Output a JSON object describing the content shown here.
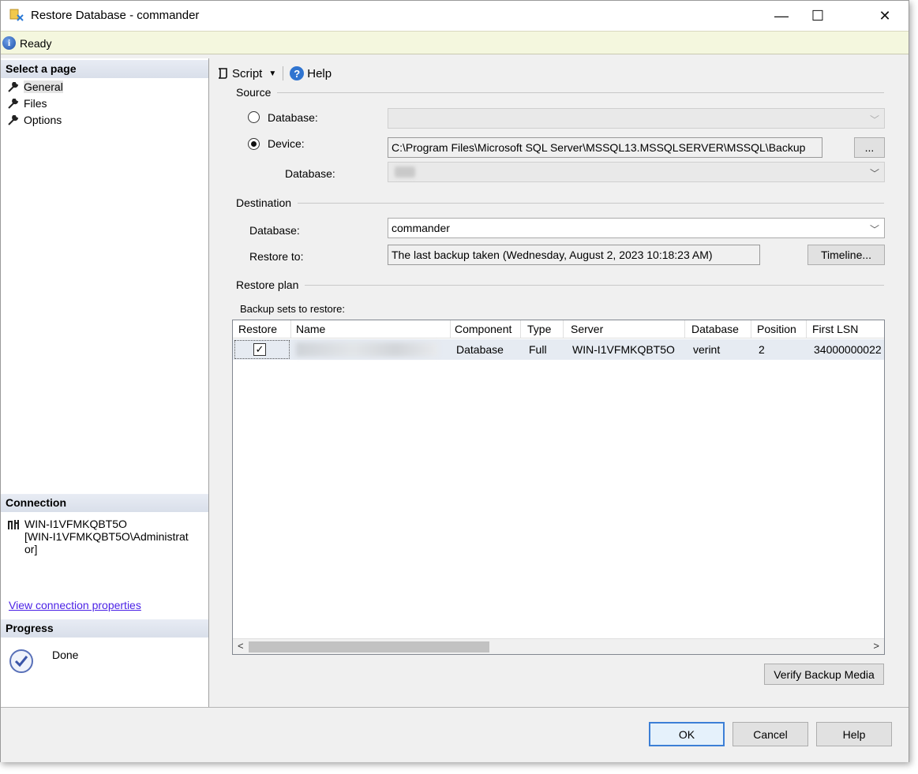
{
  "window": {
    "title": "Restore Database - commander"
  },
  "status": {
    "text": "Ready"
  },
  "sidebar": {
    "select_page_header": "Select a page",
    "pages": [
      {
        "label": "General"
      },
      {
        "label": "Files"
      },
      {
        "label": "Options"
      }
    ],
    "connection_header": "Connection",
    "connection_lines": [
      "WIN-I1VFMKQBT5O",
      "[WIN-I1VFMKQBT5O\\Administrat",
      "or]"
    ],
    "view_connection_link": "View connection properties",
    "progress_header": "Progress",
    "progress_status": "Done"
  },
  "toolbar": {
    "script_label": "Script",
    "help_label": "Help"
  },
  "source": {
    "group_label": "Source",
    "database_radio_label": "Database:",
    "device_radio_label": "Device:",
    "device_path": "C:\\Program Files\\Microsoft SQL Server\\MSSQL13.MSSQLSERVER\\MSSQL\\Backup",
    "browse_label": "...",
    "database_label": "Database:",
    "selected": "device"
  },
  "destination": {
    "group_label": "Destination",
    "database_label": "Database:",
    "database_value": "commander",
    "restore_to_label": "Restore to:",
    "restore_to_value": "The last backup taken (Wednesday, August 2, 2023 10:18:23 AM)",
    "timeline_label": "Timeline..."
  },
  "restore_plan": {
    "group_label": "Restore plan",
    "backup_sets_label": "Backup sets to restore:",
    "columns": [
      "Restore",
      "Name",
      "Component",
      "Type",
      "Server",
      "Database",
      "Position",
      "First LSN"
    ],
    "rows": [
      {
        "restore": true,
        "name": "",
        "component": "Database",
        "type": "Full",
        "server": "WIN-I1VFMKQBT5O",
        "database": "verint",
        "position": "2",
        "first_lsn": "34000000022"
      }
    ],
    "verify_label": "Verify Backup Media"
  },
  "footer": {
    "ok_label": "OK",
    "cancel_label": "Cancel",
    "help_label": "Help"
  },
  "colors": {
    "status_bg": "#f4f7de",
    "link": "#4b22e6",
    "accent": "#3c7fd6"
  }
}
